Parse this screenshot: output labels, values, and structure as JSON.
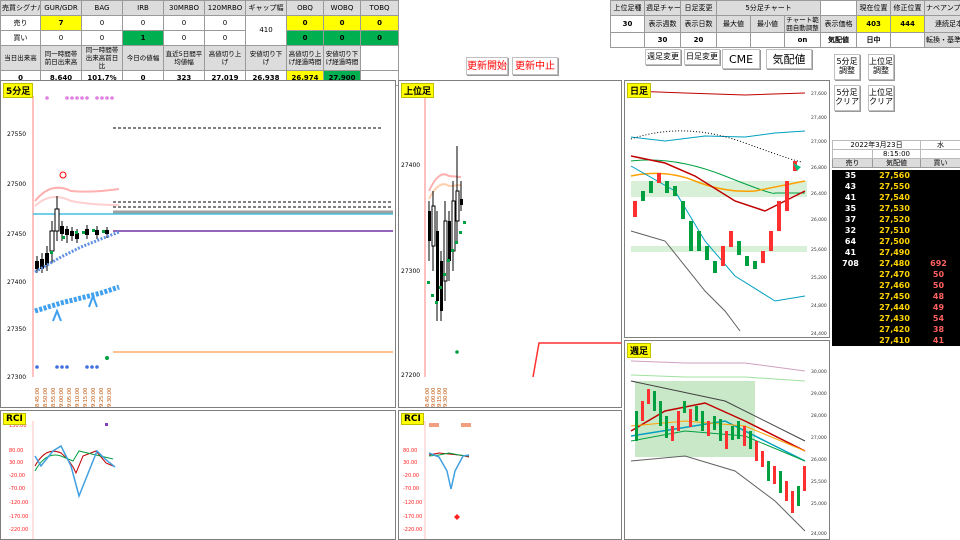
{
  "top_table": {
    "headers": [
      "売買シグナル",
      "GUR/GDR",
      "BAG",
      "IRB",
      "30MRBO",
      "120MRBO",
      "ギャップ幅",
      "OBQ",
      "WOBQ",
      "TOBQ"
    ],
    "row_sell": {
      "label": "売り",
      "values": [
        "7",
        "0",
        "0",
        "0",
        "0",
        "",
        "0",
        "0",
        "0"
      ]
    },
    "row_buy": {
      "label": "買い",
      "values": [
        "0",
        "0",
        "1",
        "0",
        "0",
        "",
        "0",
        "0",
        "0"
      ]
    },
    "gap_value": "410",
    "stats_headers": [
      "当日出来高",
      "同一時間帯前日出来高",
      "同一時間帯出来高前日比",
      "今日の値幅",
      "直近5日間平均値幅",
      "高値切り上げ",
      "安値切り下げ",
      "高値切り上げ経過時間",
      "安値切り下げ経過時間"
    ],
    "stats_values": [
      "0",
      "8,640",
      "101.7%",
      "0",
      "323",
      "27,019",
      "26,938",
      "26,974",
      "27,900"
    ]
  },
  "right_table": {
    "headers": [
      "上位足種",
      "週足チャート",
      "日足変更",
      "",
      "5分足チャート",
      "",
      "",
      "現在位置",
      "修正位置",
      "ナベアンプ売買シグナ"
    ],
    "row1_labels": [
      "30",
      "表示週数",
      "表示日数",
      "最大値",
      "最小値",
      "チャート範囲自動調整",
      "表示価格",
      "403",
      "444"
    ],
    "row2_values": [
      "",
      "30",
      "20",
      "",
      "",
      "on",
      "気配値",
      "日中"
    ],
    "extra_label": "連続足本数",
    "extra_label2": "転換・基準線区分"
  },
  "buttons": {
    "update_start": "更新開始",
    "update_stop": "更新中止",
    "weekly_change": "週足変更",
    "daily_change": "日足変更",
    "cme": "CME",
    "quote": "気配値",
    "adj5": "5分足調整",
    "upper_adj": "上位足調整",
    "clear5": "5分足クリア",
    "upper_clear": "上位足クリア"
  },
  "panels": {
    "five_min": "5分足",
    "upper": "上位足",
    "daily": "日足",
    "weekly": "週足",
    "rci_left": "RCI",
    "rci_mid": "RCI"
  },
  "five_min_axis": [
    "27550",
    "27500",
    "27450",
    "27400",
    "27350",
    "27300"
  ],
  "upper_axis": [
    "27400",
    "27300",
    "27200"
  ],
  "daily_axis": [
    "27,600",
    "27,400",
    "27,200",
    "27,000",
    "26,800",
    "26,600",
    "26,400",
    "26,200",
    "26,000",
    "25,800",
    "25,600",
    "25,400",
    "25,200",
    "25,000",
    "24,800",
    "24,600",
    "24,400",
    "24,200",
    "24,000",
    "23,800",
    "23,600"
  ],
  "weekly_axis": [
    "30,000",
    "29,500",
    "29,000",
    "28,500",
    "28,000",
    "27,500",
    "27,000",
    "26,500",
    "26,000",
    "25,500",
    "25,000",
    "24,500",
    "24,000"
  ],
  "rci_axis": [
    "130.00",
    "80.00",
    "30.00",
    "-20.00",
    "-70.00",
    "-120.00",
    "-170.00",
    "-220.00"
  ],
  "rci_axis_mid": [
    "80.00",
    "30.00",
    "-20.00",
    "-70.00",
    "-120.00",
    "-170.00",
    "-220.00"
  ],
  "x_times": [
    "8:45:00",
    "8:50:00",
    "8:55:00",
    "9:00:00",
    "9:05:00",
    "9:10:00",
    "9:15:00",
    "9:20:00",
    "9:25:00",
    "9:30:00"
  ],
  "order_book": {
    "date": "2022年3月23日",
    "weekday": "水",
    "time": "8:15:00",
    "headers": [
      "売り",
      "気配値",
      "買い"
    ],
    "rows": [
      {
        "sell": "35",
        "price": "27,560",
        "buy": ""
      },
      {
        "sell": "43",
        "price": "27,550",
        "buy": ""
      },
      {
        "sell": "41",
        "price": "27,540",
        "buy": ""
      },
      {
        "sell": "35",
        "price": "27,530",
        "buy": ""
      },
      {
        "sell": "37",
        "price": "27,520",
        "buy": ""
      },
      {
        "sell": "32",
        "price": "27,510",
        "buy": ""
      },
      {
        "sell": "64",
        "price": "27,500",
        "buy": ""
      },
      {
        "sell": "41",
        "price": "27,490",
        "buy": ""
      },
      {
        "sell": "708",
        "price": "27,480",
        "buy": "692"
      },
      {
        "sell": "",
        "price": "27,470",
        "buy": "50"
      },
      {
        "sell": "",
        "price": "27,460",
        "buy": "50"
      },
      {
        "sell": "",
        "price": "27,450",
        "buy": "48"
      },
      {
        "sell": "",
        "price": "27,440",
        "buy": "49"
      },
      {
        "sell": "",
        "price": "27,430",
        "buy": "54"
      },
      {
        "sell": "",
        "price": "27,420",
        "buy": "38"
      },
      {
        "sell": "",
        "price": "27,410",
        "buy": "41"
      }
    ]
  },
  "colors": {
    "yellow": "#ffff00",
    "green": "#00b050",
    "black": "#000000",
    "red": "#ff0000"
  }
}
